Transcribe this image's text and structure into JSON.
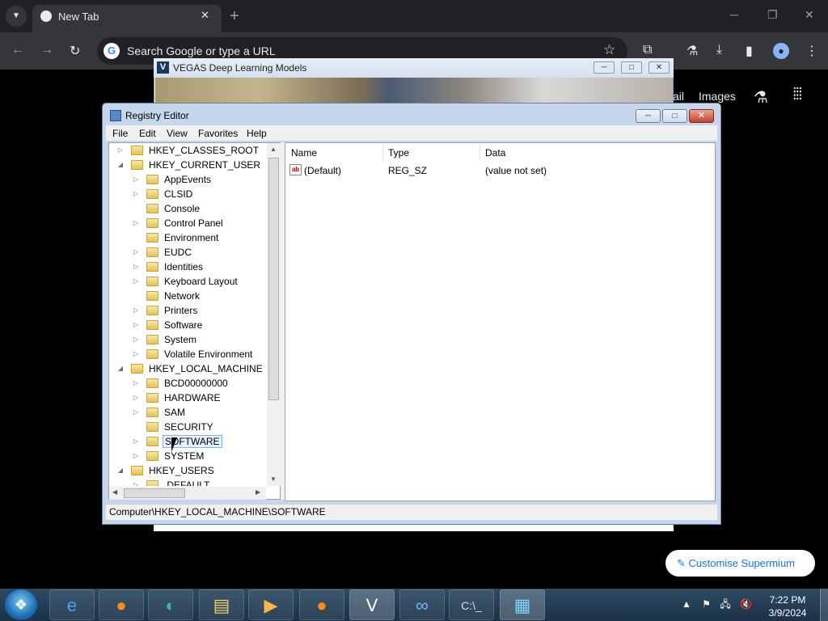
{
  "browser": {
    "tab_title": "New Tab",
    "tab_close": "✕",
    "new_tab": "+",
    "menu_icon": "chevron-down-icon",
    "omnibox_placeholder": "Search Google or type a URL",
    "toolbar_icons": [
      "extension-icon",
      "labs-icon",
      "download-icon",
      "side-panel-icon",
      "profile-icon",
      "more-icon"
    ],
    "ntp_links": {
      "gmail": "ail",
      "images": "Images"
    },
    "customise_label": "Customise Supermium"
  },
  "vegas_window": {
    "title": "VEGAS Deep Learning Models",
    "icon_letter": "V"
  },
  "registry_editor": {
    "title": "Registry Editor",
    "menu": [
      "File",
      "Edit",
      "View",
      "Favorites",
      "Help"
    ],
    "tree": [
      {
        "label": "HKEY_CLASSES_ROOT",
        "level": 0,
        "expander": "▷"
      },
      {
        "label": "HKEY_CURRENT_USER",
        "level": 0,
        "expander": "◢"
      },
      {
        "label": "AppEvents",
        "level": 1,
        "expander": "▷"
      },
      {
        "label": "CLSID",
        "level": 1,
        "expander": "▷"
      },
      {
        "label": "Console",
        "level": 1,
        "expander": ""
      },
      {
        "label": "Control Panel",
        "level": 1,
        "expander": "▷"
      },
      {
        "label": "Environment",
        "level": 1,
        "expander": ""
      },
      {
        "label": "EUDC",
        "level": 1,
        "expander": "▷"
      },
      {
        "label": "Identities",
        "level": 1,
        "expander": "▷"
      },
      {
        "label": "Keyboard Layout",
        "level": 1,
        "expander": "▷"
      },
      {
        "label": "Network",
        "level": 1,
        "expander": ""
      },
      {
        "label": "Printers",
        "level": 1,
        "expander": "▷"
      },
      {
        "label": "Software",
        "level": 1,
        "expander": "▷"
      },
      {
        "label": "System",
        "level": 1,
        "expander": "▷"
      },
      {
        "label": "Volatile Environment",
        "level": 1,
        "expander": "▷"
      },
      {
        "label": "HKEY_LOCAL_MACHINE",
        "level": 0,
        "expander": "◢"
      },
      {
        "label": "BCD00000000",
        "level": 1,
        "expander": "▷"
      },
      {
        "label": "HARDWARE",
        "level": 1,
        "expander": "▷"
      },
      {
        "label": "SAM",
        "level": 1,
        "expander": "▷"
      },
      {
        "label": "SECURITY",
        "level": 1,
        "expander": ""
      },
      {
        "label": "SOFTWARE",
        "level": 1,
        "expander": "▷",
        "selected": true
      },
      {
        "label": "SYSTEM",
        "level": 1,
        "expander": "▷"
      },
      {
        "label": "HKEY_USERS",
        "level": 0,
        "expander": "◢"
      },
      {
        "label": ".DEFAULT",
        "level": 1,
        "expander": "▷"
      }
    ],
    "columns": [
      "Name",
      "Type",
      "Data"
    ],
    "rows": [
      {
        "icon": "ab",
        "name": "(Default)",
        "type": "REG_SZ",
        "data": "(value not set)"
      }
    ],
    "status_path": "Computer\\HKEY_LOCAL_MACHINE\\SOFTWARE"
  },
  "taskbar": {
    "apps": [
      "internet-explorer-icon",
      "firefox-icon",
      "supermium-icon",
      "file-explorer-icon",
      "media-player-icon",
      "firefox-icon",
      "vegas-icon",
      "infinity-app-icon",
      "command-prompt-icon",
      "registry-editor-icon"
    ],
    "clock_time": "7:22 PM",
    "clock_date": "3/9/2024"
  }
}
